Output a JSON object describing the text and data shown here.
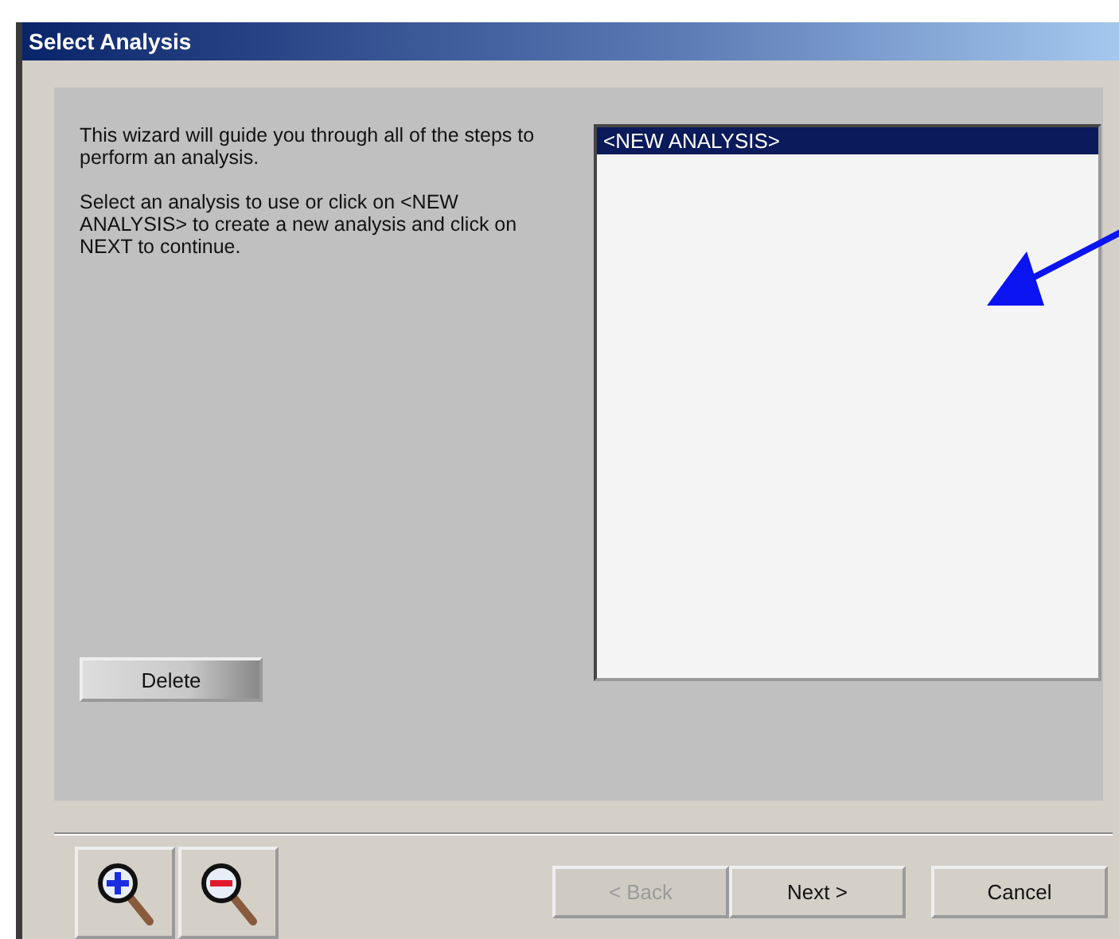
{
  "window": {
    "title": "Select Analysis"
  },
  "instructions": [
    "This wizard will guide you through all of the steps to perform an analysis.",
    "Select an analysis to use or click on <NEW ANALYSIS> to create a new analysis and click on NEXT to continue."
  ],
  "analyses": [
    {
      "label": "<NEW ANALYSIS>",
      "selected": true
    }
  ],
  "delete_button": {
    "label": "Delete"
  },
  "zoom_buttons": [
    {
      "kind": "zoom-in"
    },
    {
      "kind": "zoom-out"
    }
  ],
  "nav_buttons": [
    {
      "label": "< Back",
      "disabled": true
    },
    {
      "label": "Next >",
      "disabled": false
    },
    {
      "label": "Cancel",
      "disabled": false
    }
  ]
}
